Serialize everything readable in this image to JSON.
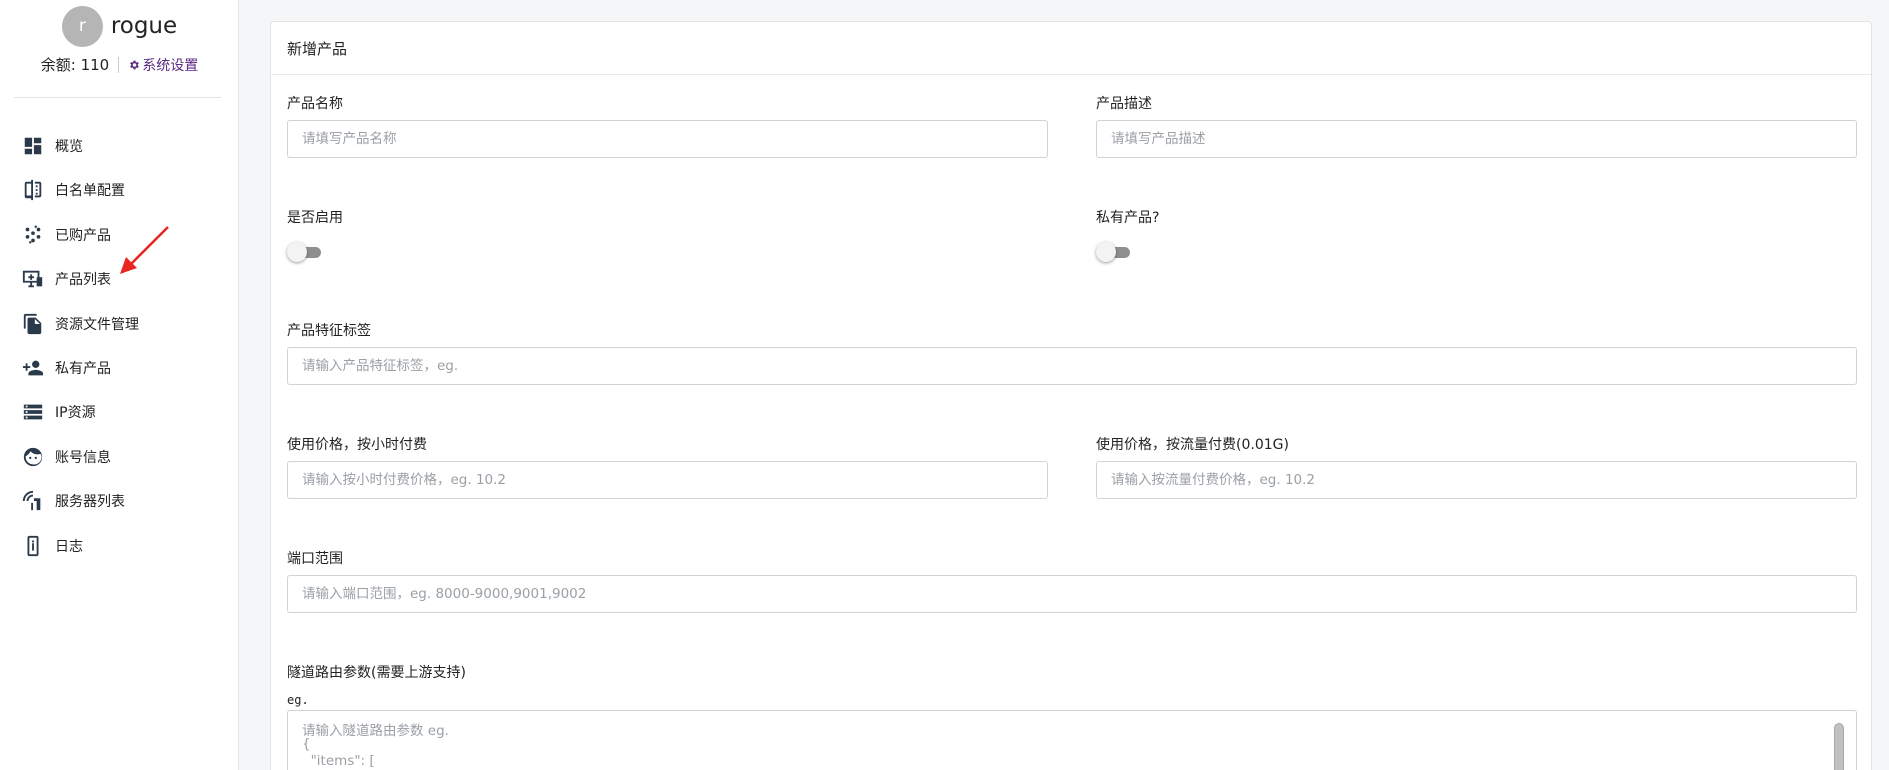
{
  "user": {
    "avatar_letter": "r",
    "name": "rogue",
    "balance": "余额: 110",
    "settings": "系统设置"
  },
  "menu": [
    {
      "label": "概览",
      "icon": "dashboard-icon"
    },
    {
      "label": "白名单配置",
      "icon": "compare-icon"
    },
    {
      "label": "已购产品",
      "icon": "grain-icon"
    },
    {
      "label": "产品列表",
      "icon": "monitor-icon"
    },
    {
      "label": "资源文件管理",
      "icon": "files-icon"
    },
    {
      "label": "私有产品",
      "icon": "person-add-icon"
    },
    {
      "label": "IP资源",
      "icon": "storage-icon"
    },
    {
      "label": "账号信息",
      "icon": "face-icon"
    },
    {
      "label": "服务器列表",
      "icon": "signal-icon"
    },
    {
      "label": "日志",
      "icon": "phone-info-icon"
    }
  ],
  "form": {
    "title": "新增产品",
    "name_label": "产品名称",
    "name_placeholder": "请填写产品名称",
    "desc_label": "产品描述",
    "desc_placeholder": "请填写产品描述",
    "enabled_label": "是否启用",
    "enabled": false,
    "private_label": "私有产品?",
    "private": false,
    "tags_label": "产品特征标签",
    "tags_placeholder": "请输入产品特征标签，eg.",
    "hour_price_label": "使用价格，按小时付费",
    "hour_price_placeholder": "请输入按小时付费价格，eg. 10.2",
    "traffic_price_label": "使用价格，按流量付费(0.01G)",
    "traffic_price_placeholder": "请输入按流量付费价格，eg. 10.2",
    "port_label": "端口范围",
    "port_placeholder": "请输入端口范围，eg. 8000-9000,9001,9002",
    "route_label": "隧道路由参数(需要上游支持)",
    "route_eg": "eg.",
    "route_placeholder_lines": [
      "请输入隧道路由参数 eg.",
      "{",
      "  \"items\": ["
    ]
  },
  "colors": {
    "settings_link": "#5a2a82",
    "arrow": "#e8251f"
  }
}
